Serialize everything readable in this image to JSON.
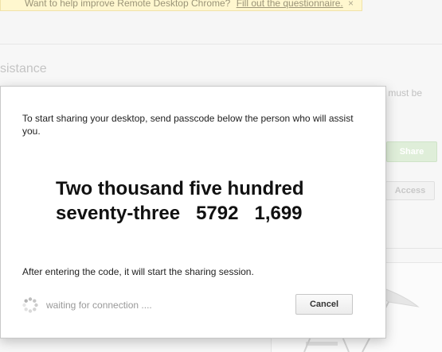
{
  "banner": {
    "text": "Want to help improve Remote Desktop Chrome?",
    "link_label": "Fill out the questionnaire.",
    "close_icon": "×"
  },
  "background": {
    "section_title": "sistance",
    "text_fragment": "s must be",
    "share_label": "Share",
    "access_label": "Access"
  },
  "dialog": {
    "instructions": "To start sharing your desktop, send passcode below the person who will assist you.",
    "passcode": "Two thousand five hundred\nseventy-three   5792   1,699",
    "after_text": "After entering the code, it will start the sharing session.",
    "waiting_text": "waiting for connection ....",
    "cancel_label": "Cancel",
    "spinner_icon": "spinner-icon"
  },
  "colors": {
    "banner_bg": "#fff7cf",
    "share_button": "#dfeed9",
    "dialog_bg": "#ffffff"
  }
}
